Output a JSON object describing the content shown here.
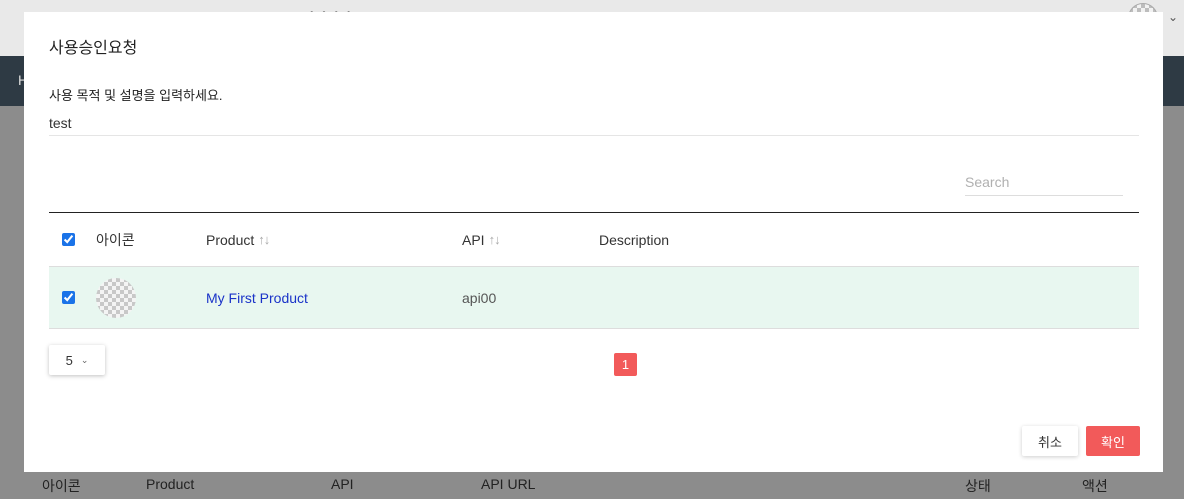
{
  "background": {
    "header_dots": "• • • •",
    "nav_letter": "H",
    "user_menu_caret": "⌄",
    "table_headers": [
      "아이콘",
      "Product",
      "API",
      "API URL",
      "상태",
      "액션"
    ]
  },
  "modal": {
    "title": "사용승인요청",
    "description_label": "사용 목적 및 설명을 입력하세요.",
    "description_value": "test",
    "search_placeholder": "Search",
    "columns": {
      "icon": "아이콘",
      "product": "Product",
      "api": "API",
      "description": "Description",
      "sort_glyph": "↑↓"
    },
    "rows": [
      {
        "product": "My First Product",
        "api": "api00",
        "description": "",
        "checked": true
      }
    ],
    "header_checked": true,
    "page_size": "5",
    "page_size_chevron": "⌄",
    "current_page": "1",
    "cancel_label": "취소",
    "confirm_label": "확인"
  },
  "colors": {
    "accent": "#f25a5a",
    "selected_row": "#e8f7f0",
    "link": "#1a33c8",
    "nav": "#2e3a44"
  }
}
